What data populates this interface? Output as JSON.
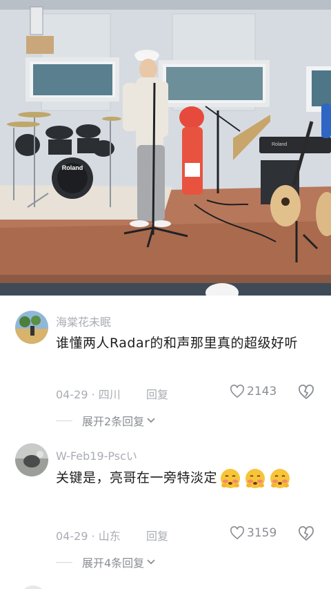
{
  "comments": [
    {
      "username": "海棠花未眠",
      "text": "谁懂两人Radar的和声那里真的超级好听",
      "date": "04-29",
      "location": "四川",
      "reply_label": "回复",
      "likes": "2143",
      "expand_label": "展开2条回复",
      "avatar": "landscape-avatar"
    },
    {
      "username": "W-Feb19-Pscい",
      "text": "关键是，亮哥在一旁特淡定",
      "emoji_count": 3,
      "emoji_name": "shy-face-emoji",
      "date": "04-29",
      "location": "山东",
      "reply_label": "回复",
      "likes": "3159",
      "expand_label": "展开4条回复",
      "avatar": "photo-avatar"
    }
  ],
  "video": {
    "drum_brand": "Roland",
    "keyboard_brand": "Roland"
  }
}
